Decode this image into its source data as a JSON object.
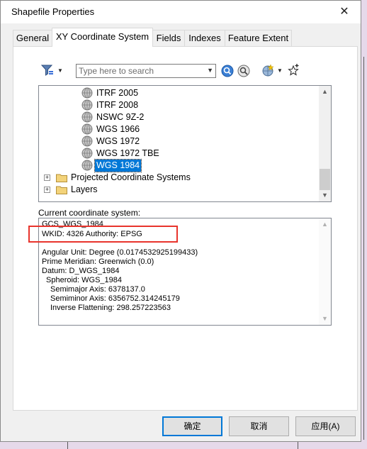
{
  "window": {
    "title": "Shapefile Properties",
    "close_glyph": "✕"
  },
  "tabs": [
    {
      "label": "General",
      "active": false
    },
    {
      "label": "XY Coordinate System",
      "active": true
    },
    {
      "label": "Fields",
      "active": false
    },
    {
      "label": "Indexes",
      "active": false
    },
    {
      "label": "Feature Extent",
      "active": false
    }
  ],
  "toolbar": {
    "search_placeholder": "Type here to search",
    "icons": [
      "filter-icon",
      "search-icon",
      "locate-icon",
      "globe-new-icon",
      "add-favorite-icon"
    ]
  },
  "tree": {
    "items": [
      {
        "label": "ITRF 2005",
        "kind": "coordinate-system"
      },
      {
        "label": "ITRF 2008",
        "kind": "coordinate-system"
      },
      {
        "label": "NSWC 9Z-2",
        "kind": "coordinate-system"
      },
      {
        "label": "WGS 1966",
        "kind": "coordinate-system"
      },
      {
        "label": "WGS 1972",
        "kind": "coordinate-system"
      },
      {
        "label": "WGS 1972 TBE",
        "kind": "coordinate-system"
      },
      {
        "label": "WGS 1984",
        "kind": "coordinate-system",
        "selected": true
      },
      {
        "label": "Projected Coordinate Systems",
        "kind": "folder"
      },
      {
        "label": "Layers",
        "kind": "folder"
      }
    ]
  },
  "current": {
    "label": "Current coordinate system:",
    "lines": [
      "GCS_WGS_1984",
      "WKID: 4326 Authority: EPSG",
      "",
      "Angular Unit: Degree (0.0174532925199433)",
      "Prime Meridian: Greenwich (0.0)",
      "Datum: D_WGS_1984",
      "  Spheroid: WGS_1984",
      "    Semimajor Axis: 6378137.0",
      "    Semiminor Axis: 6356752.314245179",
      "    Inverse Flattening: 298.257223563"
    ]
  },
  "buttons": {
    "ok": "确定",
    "cancel": "取消",
    "apply": "应用(A)"
  },
  "colors": {
    "selection": "#0078d7",
    "highlight_box": "#e8342c"
  }
}
